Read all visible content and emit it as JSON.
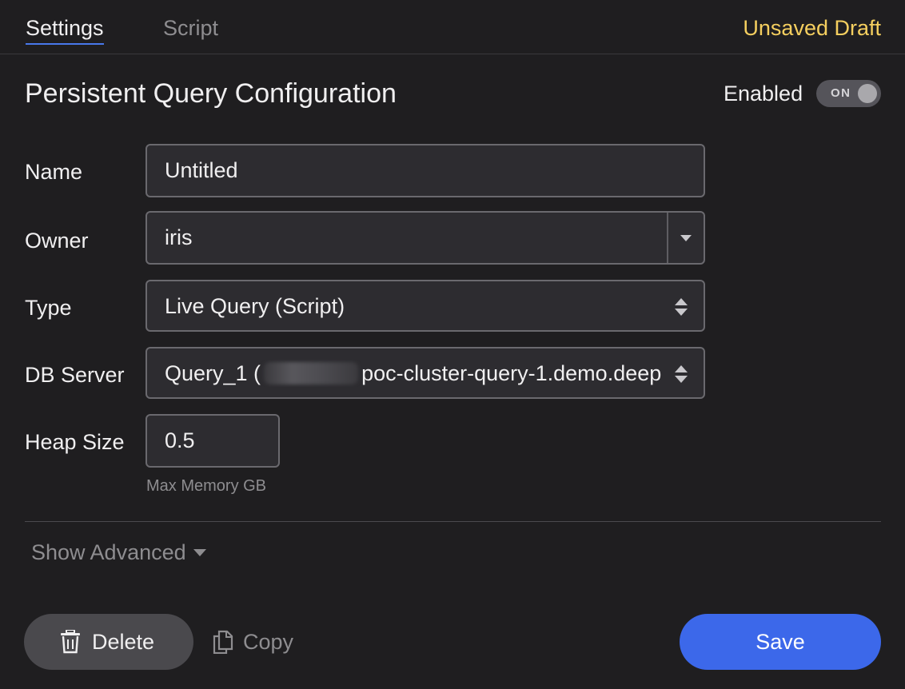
{
  "tabs": [
    {
      "label": "Settings",
      "active": true
    },
    {
      "label": "Script",
      "active": false
    }
  ],
  "status": "Unsaved Draft",
  "page_title": "Persistent Query Configuration",
  "enabled": {
    "label": "Enabled",
    "toggle_text": "ON",
    "state": true
  },
  "form": {
    "name": {
      "label": "Name",
      "value": "Untitled"
    },
    "owner": {
      "label": "Owner",
      "value": "iris"
    },
    "type": {
      "label": "Type",
      "value": "Live Query (Script)"
    },
    "db_server": {
      "label": "DB Server",
      "value_prefix": "Query_1 (",
      "value_suffix": "poc-cluster-query-1.demo.deep"
    },
    "heap_size": {
      "label": "Heap Size",
      "value": "0.5",
      "hint": "Max Memory GB"
    }
  },
  "show_advanced": "Show Advanced",
  "buttons": {
    "delete": "Delete",
    "copy": "Copy",
    "save": "Save"
  },
  "colors": {
    "accent": "#3c68ea",
    "draft": "#f5cf5f",
    "background": "#1f1e20"
  },
  "icons": {
    "delete": "trash-icon",
    "copy": "copy-icon"
  }
}
